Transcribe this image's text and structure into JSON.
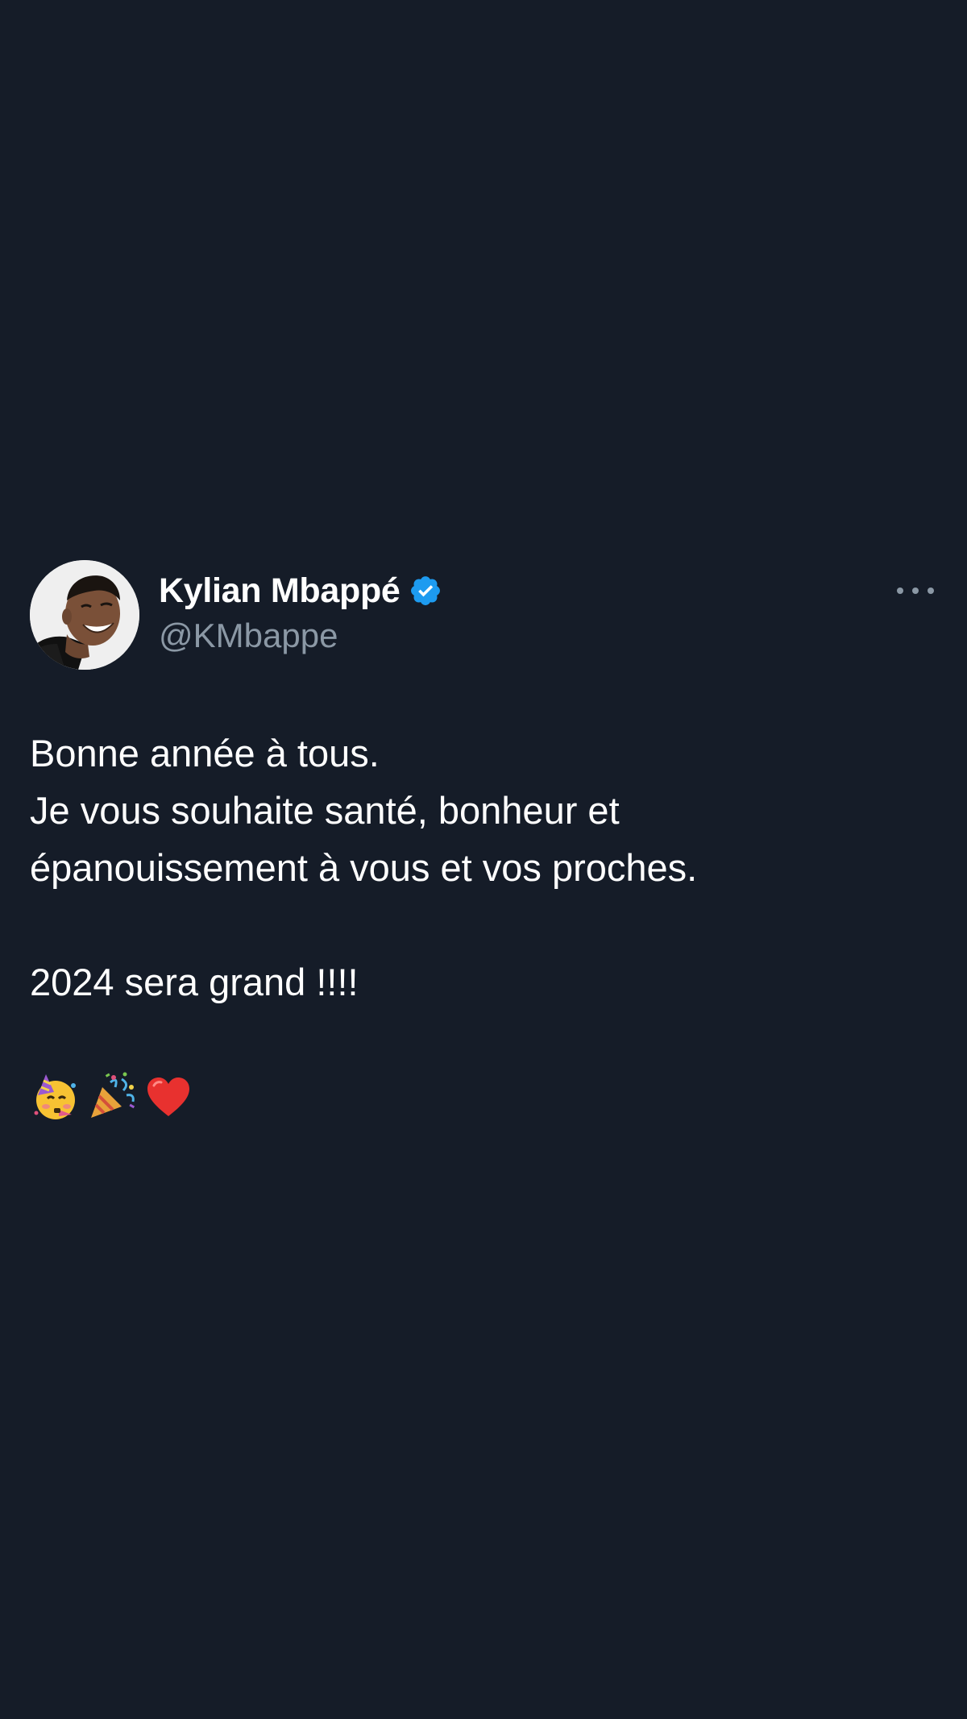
{
  "tweet": {
    "author": {
      "display_name": "Kylian Mbappé",
      "handle": "@KMbappe",
      "verified": true,
      "verified_color": "#1d9bf0"
    },
    "text_lines": [
      "Bonne année à tous.",
      "Je vous souhaite santé, bonheur et",
      "épanouissement à vous et vos proches.",
      "",
      "2024 sera grand !!!!",
      ""
    ],
    "emojis": [
      "partying-face-emoji",
      "party-popper-emoji",
      "red-heart-emoji"
    ],
    "more_icon": "more-horizontal-icon"
  },
  "colors": {
    "background": "#151c28",
    "text_primary": "#ffffff",
    "text_secondary": "#8b98a5"
  }
}
